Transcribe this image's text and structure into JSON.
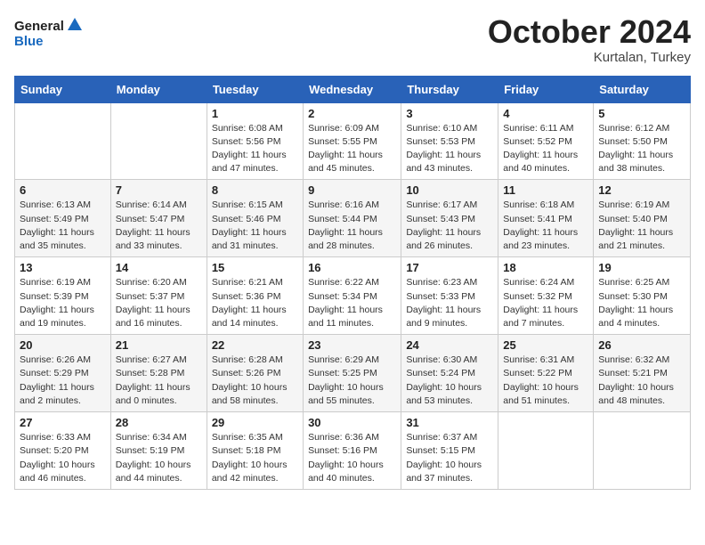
{
  "header": {
    "logo_line1": "General",
    "logo_line2": "Blue",
    "month": "October 2024",
    "location": "Kurtalan, Turkey"
  },
  "weekdays": [
    "Sunday",
    "Monday",
    "Tuesday",
    "Wednesday",
    "Thursday",
    "Friday",
    "Saturday"
  ],
  "weeks": [
    [
      {
        "day": "",
        "info": ""
      },
      {
        "day": "",
        "info": ""
      },
      {
        "day": "1",
        "info": "Sunrise: 6:08 AM\nSunset: 5:56 PM\nDaylight: 11 hours and 47 minutes."
      },
      {
        "day": "2",
        "info": "Sunrise: 6:09 AM\nSunset: 5:55 PM\nDaylight: 11 hours and 45 minutes."
      },
      {
        "day": "3",
        "info": "Sunrise: 6:10 AM\nSunset: 5:53 PM\nDaylight: 11 hours and 43 minutes."
      },
      {
        "day": "4",
        "info": "Sunrise: 6:11 AM\nSunset: 5:52 PM\nDaylight: 11 hours and 40 minutes."
      },
      {
        "day": "5",
        "info": "Sunrise: 6:12 AM\nSunset: 5:50 PM\nDaylight: 11 hours and 38 minutes."
      }
    ],
    [
      {
        "day": "6",
        "info": "Sunrise: 6:13 AM\nSunset: 5:49 PM\nDaylight: 11 hours and 35 minutes."
      },
      {
        "day": "7",
        "info": "Sunrise: 6:14 AM\nSunset: 5:47 PM\nDaylight: 11 hours and 33 minutes."
      },
      {
        "day": "8",
        "info": "Sunrise: 6:15 AM\nSunset: 5:46 PM\nDaylight: 11 hours and 31 minutes."
      },
      {
        "day": "9",
        "info": "Sunrise: 6:16 AM\nSunset: 5:44 PM\nDaylight: 11 hours and 28 minutes."
      },
      {
        "day": "10",
        "info": "Sunrise: 6:17 AM\nSunset: 5:43 PM\nDaylight: 11 hours and 26 minutes."
      },
      {
        "day": "11",
        "info": "Sunrise: 6:18 AM\nSunset: 5:41 PM\nDaylight: 11 hours and 23 minutes."
      },
      {
        "day": "12",
        "info": "Sunrise: 6:19 AM\nSunset: 5:40 PM\nDaylight: 11 hours and 21 minutes."
      }
    ],
    [
      {
        "day": "13",
        "info": "Sunrise: 6:19 AM\nSunset: 5:39 PM\nDaylight: 11 hours and 19 minutes."
      },
      {
        "day": "14",
        "info": "Sunrise: 6:20 AM\nSunset: 5:37 PM\nDaylight: 11 hours and 16 minutes."
      },
      {
        "day": "15",
        "info": "Sunrise: 6:21 AM\nSunset: 5:36 PM\nDaylight: 11 hours and 14 minutes."
      },
      {
        "day": "16",
        "info": "Sunrise: 6:22 AM\nSunset: 5:34 PM\nDaylight: 11 hours and 11 minutes."
      },
      {
        "day": "17",
        "info": "Sunrise: 6:23 AM\nSunset: 5:33 PM\nDaylight: 11 hours and 9 minutes."
      },
      {
        "day": "18",
        "info": "Sunrise: 6:24 AM\nSunset: 5:32 PM\nDaylight: 11 hours and 7 minutes."
      },
      {
        "day": "19",
        "info": "Sunrise: 6:25 AM\nSunset: 5:30 PM\nDaylight: 11 hours and 4 minutes."
      }
    ],
    [
      {
        "day": "20",
        "info": "Sunrise: 6:26 AM\nSunset: 5:29 PM\nDaylight: 11 hours and 2 minutes."
      },
      {
        "day": "21",
        "info": "Sunrise: 6:27 AM\nSunset: 5:28 PM\nDaylight: 11 hours and 0 minutes."
      },
      {
        "day": "22",
        "info": "Sunrise: 6:28 AM\nSunset: 5:26 PM\nDaylight: 10 hours and 58 minutes."
      },
      {
        "day": "23",
        "info": "Sunrise: 6:29 AM\nSunset: 5:25 PM\nDaylight: 10 hours and 55 minutes."
      },
      {
        "day": "24",
        "info": "Sunrise: 6:30 AM\nSunset: 5:24 PM\nDaylight: 10 hours and 53 minutes."
      },
      {
        "day": "25",
        "info": "Sunrise: 6:31 AM\nSunset: 5:22 PM\nDaylight: 10 hours and 51 minutes."
      },
      {
        "day": "26",
        "info": "Sunrise: 6:32 AM\nSunset: 5:21 PM\nDaylight: 10 hours and 48 minutes."
      }
    ],
    [
      {
        "day": "27",
        "info": "Sunrise: 6:33 AM\nSunset: 5:20 PM\nDaylight: 10 hours and 46 minutes."
      },
      {
        "day": "28",
        "info": "Sunrise: 6:34 AM\nSunset: 5:19 PM\nDaylight: 10 hours and 44 minutes."
      },
      {
        "day": "29",
        "info": "Sunrise: 6:35 AM\nSunset: 5:18 PM\nDaylight: 10 hours and 42 minutes."
      },
      {
        "day": "30",
        "info": "Sunrise: 6:36 AM\nSunset: 5:16 PM\nDaylight: 10 hours and 40 minutes."
      },
      {
        "day": "31",
        "info": "Sunrise: 6:37 AM\nSunset: 5:15 PM\nDaylight: 10 hours and 37 minutes."
      },
      {
        "day": "",
        "info": ""
      },
      {
        "day": "",
        "info": ""
      }
    ]
  ]
}
